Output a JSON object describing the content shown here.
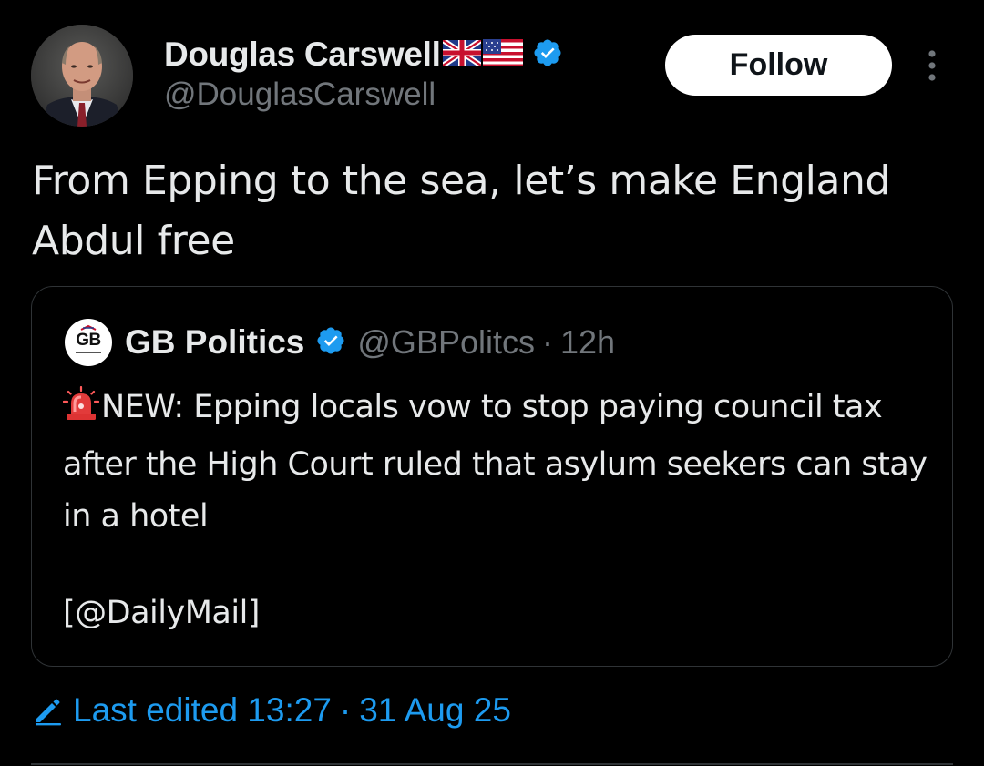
{
  "author": {
    "name": "Douglas Carswell",
    "handle": "@DouglasCarswell",
    "flags": [
      "uk-flag-icon",
      "us-flag-icon"
    ],
    "verified_icon": "verified-badge-icon"
  },
  "actions": {
    "follow_label": "Follow",
    "more_icon": "more-vertical-icon"
  },
  "tweet": {
    "text": "From Epping to the sea, let’s make England Abdul free"
  },
  "quoted": {
    "avatar_label": "GB",
    "name": "GB Politics",
    "handle": "@GBPolitcs",
    "separator": "·",
    "time": "12h",
    "body_icon": "siren-icon",
    "body": "NEW: Epping locals vow to stop paying council tax after the High Court ruled that asylum seekers can stay in a hotel",
    "source": "[@DailyMail]"
  },
  "edit_info": {
    "icon": "pencil-icon",
    "label": "Last edited 13:27",
    "separator": "·",
    "date": "31 Aug 25"
  },
  "colors": {
    "background": "#000000",
    "text": "#e7e9ea",
    "secondary_text": "#71767b",
    "accent": "#1d9bf0",
    "border": "#2f3336"
  }
}
